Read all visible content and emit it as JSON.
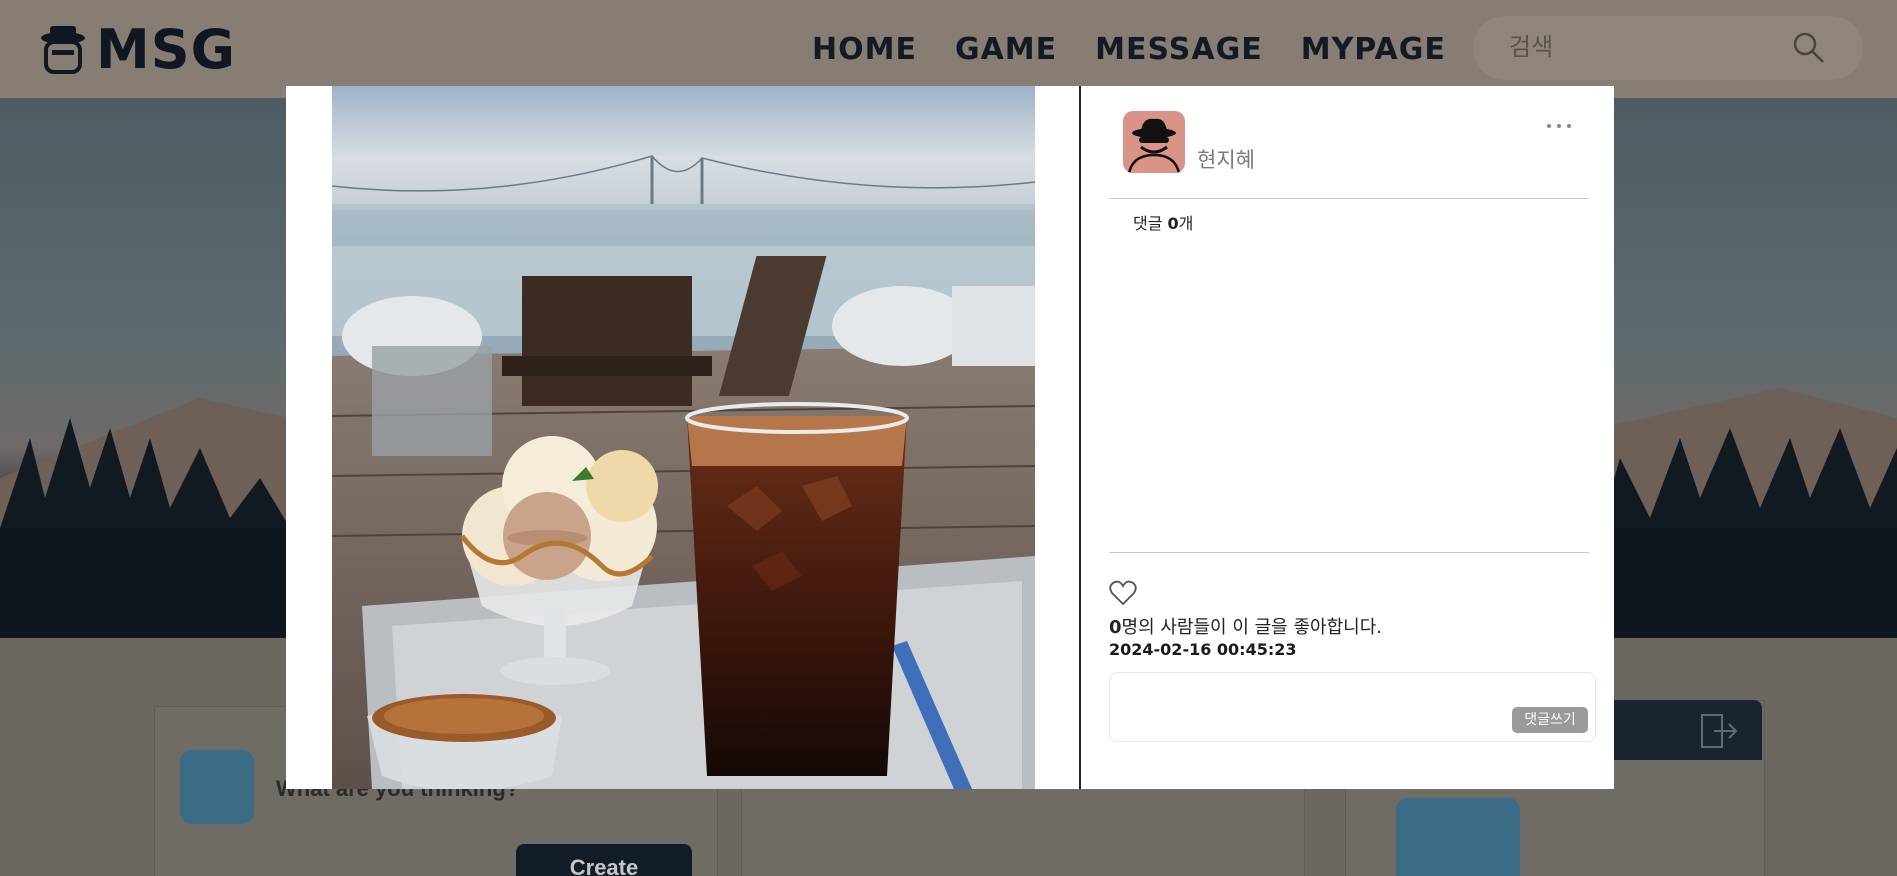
{
  "header": {
    "logo_text": "MSG",
    "nav": [
      "HOME",
      "GAME",
      "MESSAGE",
      "MYPAGE"
    ],
    "search_placeholder": "검색"
  },
  "background": {
    "composer_prompt": "What are you thinking?",
    "create_label": "Create"
  },
  "post": {
    "author": "현지혜",
    "comments_prefix": "댓글 ",
    "comments_count": "0",
    "comments_suffix": "개",
    "likes_count": "0",
    "likes_suffix": "명의 사람들이 이 글을 좋아합니다.",
    "date": "2024-02-16 00:45:23",
    "comment_submit_label": "댓글쓰기"
  },
  "icons": {
    "search": "search-icon",
    "more": "more-options-icon",
    "like": "heart-icon",
    "logout": "logout-icon"
  },
  "colors": {
    "modal_bg": "#ffffff",
    "author_avatar_bg": "#d99487",
    "submit_button": "#9a9a9a"
  }
}
